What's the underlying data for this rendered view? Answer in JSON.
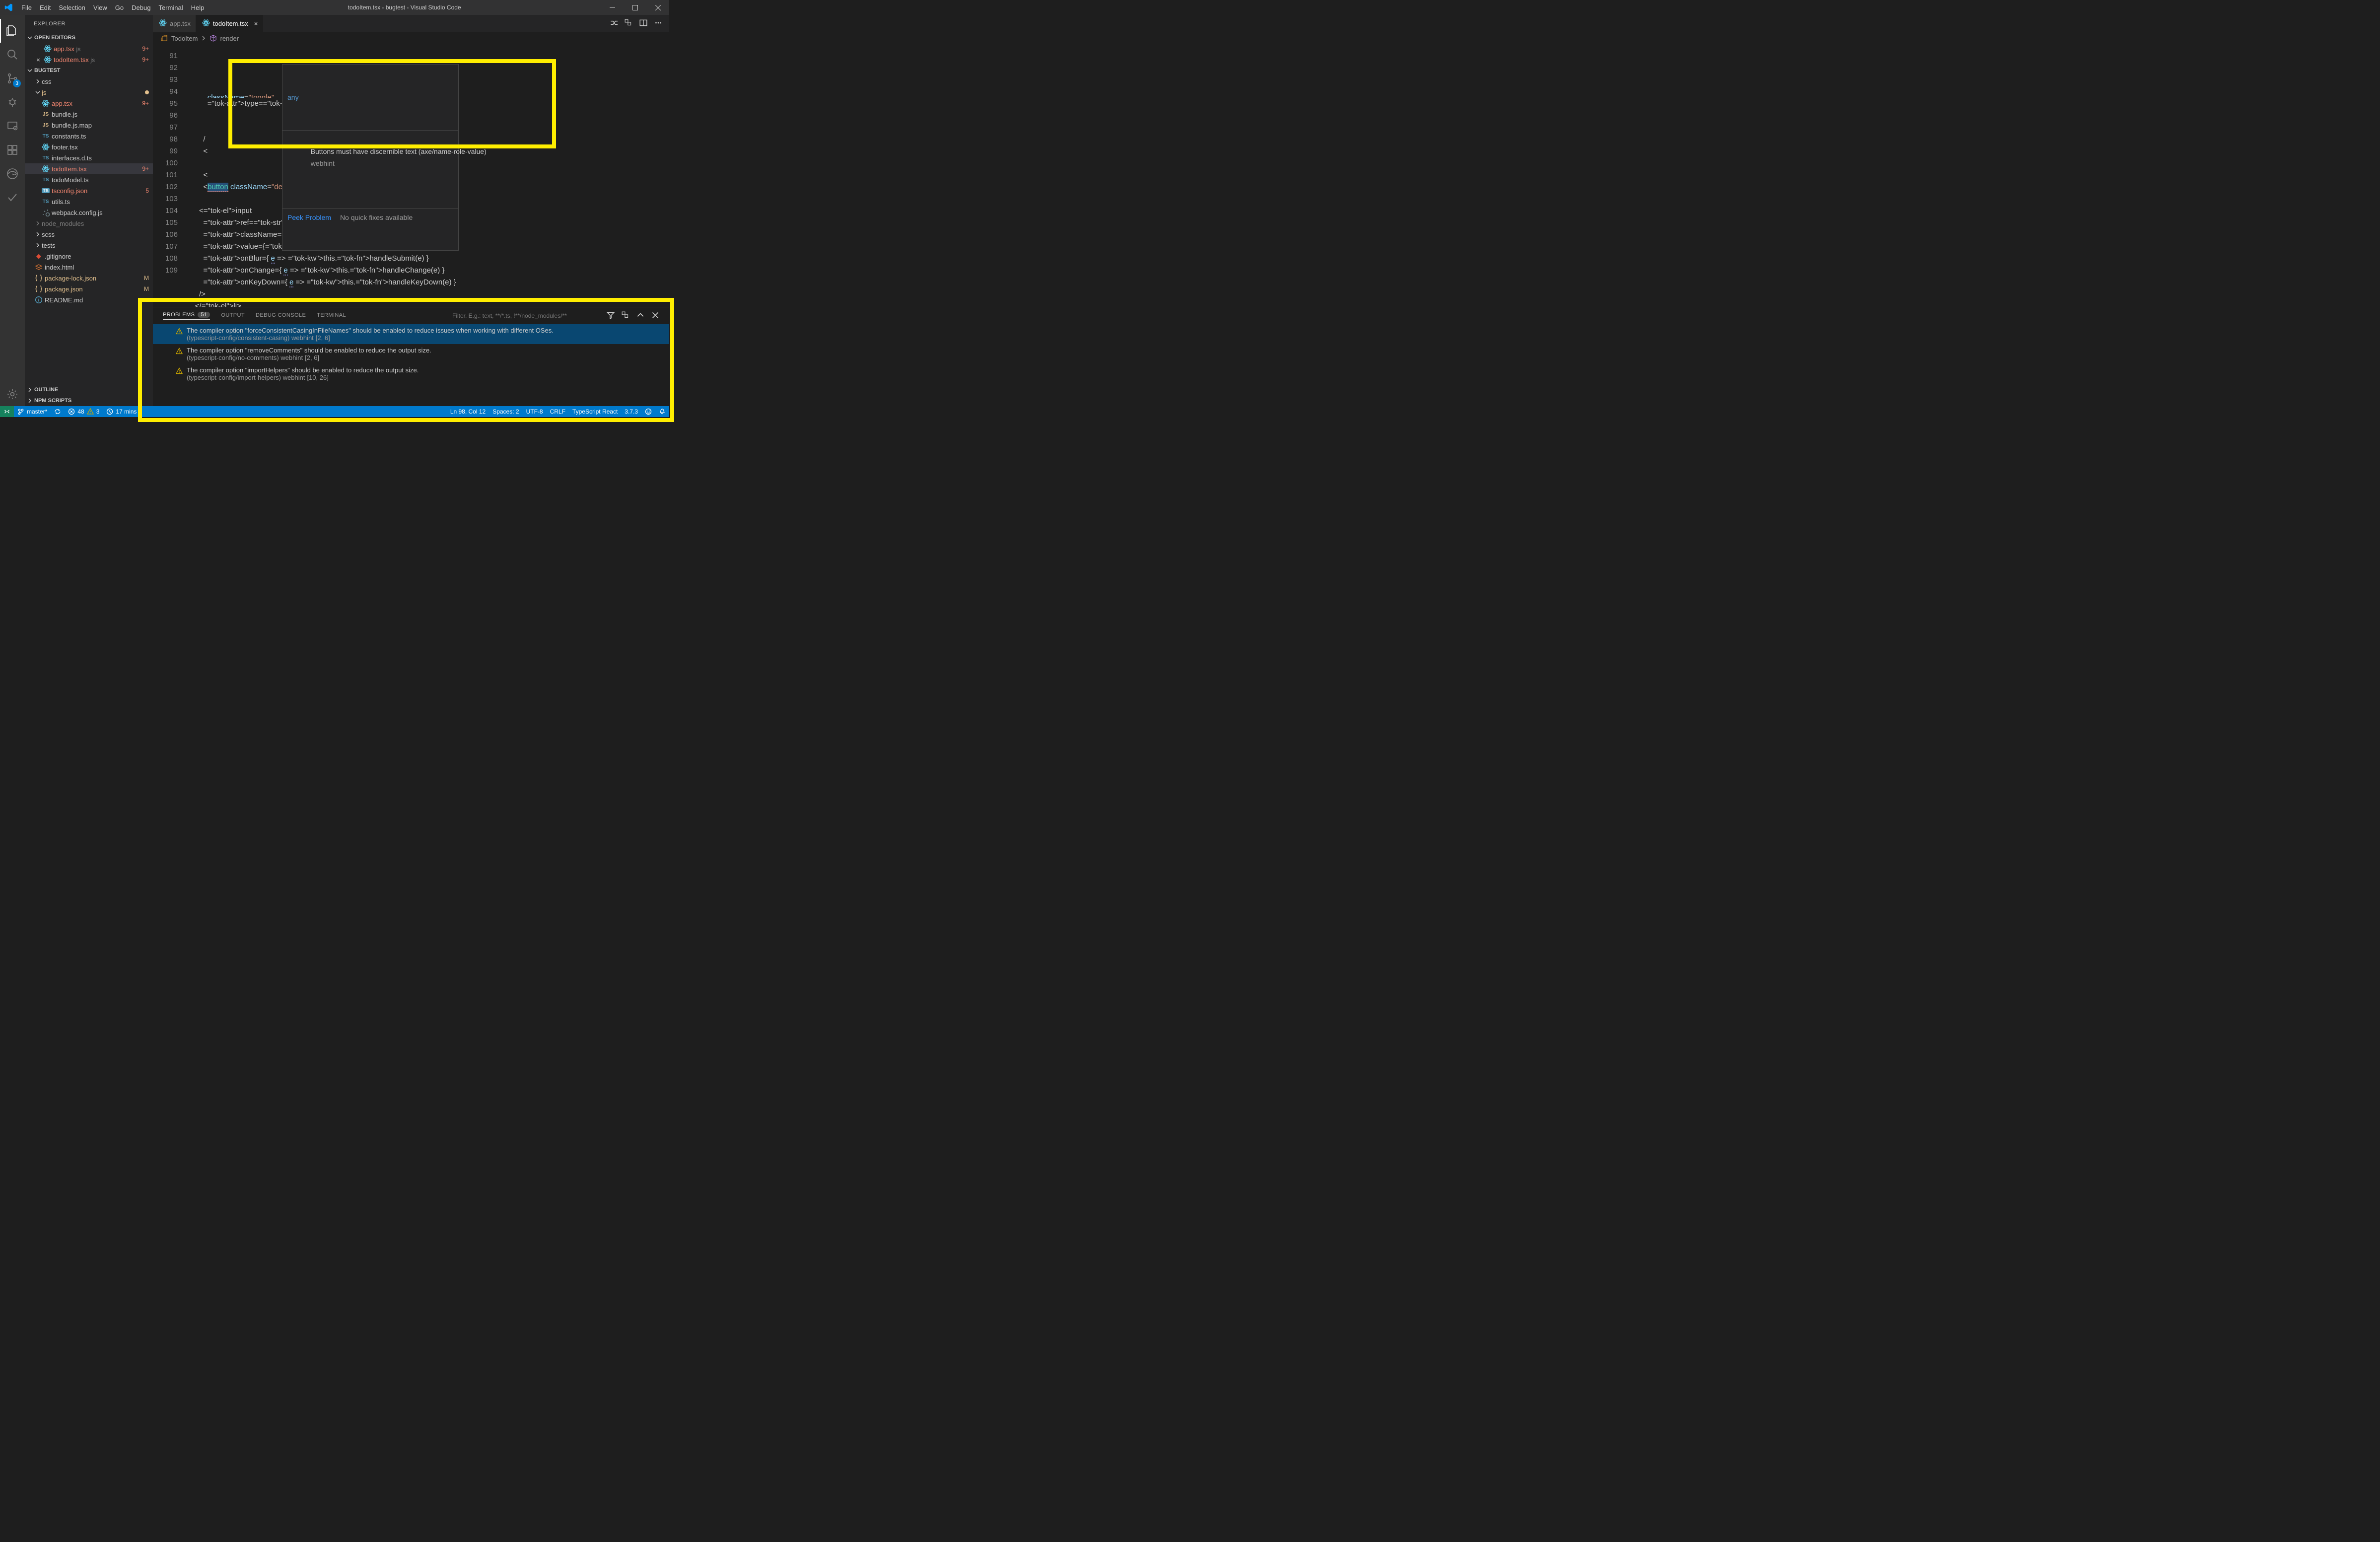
{
  "title": "todoItem.tsx - bugtest - Visual Studio Code",
  "menu": [
    "File",
    "Edit",
    "Selection",
    "View",
    "Go",
    "Debug",
    "Terminal",
    "Help"
  ],
  "activity": {
    "scm_badge": "3"
  },
  "sidebar": {
    "title": "EXPLORER",
    "panes": {
      "openEditors": "OPEN EDITORS",
      "project": "BUGTEST",
      "outline": "OUTLINE",
      "npm": "NPM SCRIPTS"
    },
    "openEditors": [
      {
        "name": "app.tsx",
        "tag": "js",
        "badge": "9+",
        "err": true
      },
      {
        "name": "todoItem.tsx",
        "tag": "js",
        "badge": "9+",
        "err": true,
        "active": true
      }
    ],
    "tree": [
      {
        "t": "dir",
        "name": "css",
        "d": 1,
        "open": false
      },
      {
        "t": "dir",
        "name": "js",
        "d": 1,
        "open": true,
        "mod": true
      },
      {
        "t": "file",
        "name": "app.tsx",
        "d": 2,
        "ic": "react",
        "err": true,
        "badge": "9+"
      },
      {
        "t": "file",
        "name": "bundle.js",
        "d": 2,
        "ic": "js"
      },
      {
        "t": "file",
        "name": "bundle.js.map",
        "d": 2,
        "ic": "js"
      },
      {
        "t": "file",
        "name": "constants.ts",
        "d": 2,
        "ic": "ts"
      },
      {
        "t": "file",
        "name": "footer.tsx",
        "d": 2,
        "ic": "react"
      },
      {
        "t": "file",
        "name": "interfaces.d.ts",
        "d": 2,
        "ic": "ts"
      },
      {
        "t": "file",
        "name": "todoItem.tsx",
        "d": 2,
        "ic": "react",
        "err": true,
        "badge": "9+",
        "sel": true
      },
      {
        "t": "file",
        "name": "todoModel.ts",
        "d": 2,
        "ic": "ts"
      },
      {
        "t": "file",
        "name": "tsconfig.json",
        "d": 2,
        "ic": "tsd",
        "err": true,
        "badge": "5"
      },
      {
        "t": "file",
        "name": "utils.ts",
        "d": 2,
        "ic": "ts"
      },
      {
        "t": "file",
        "name": "webpack.config.js",
        "d": 2,
        "ic": "gear"
      },
      {
        "t": "dir",
        "name": "node_modules",
        "d": 1,
        "open": false,
        "dim": true
      },
      {
        "t": "dir",
        "name": "scss",
        "d": 1,
        "open": false
      },
      {
        "t": "dir",
        "name": "tests",
        "d": 1,
        "open": false
      },
      {
        "t": "file",
        "name": ".gitignore",
        "d": 1,
        "ic": "git"
      },
      {
        "t": "file",
        "name": "index.html",
        "d": 1,
        "ic": "html"
      },
      {
        "t": "file",
        "name": "package-lock.json",
        "d": 1,
        "ic": "json",
        "mod": true,
        "badge": "M"
      },
      {
        "t": "file",
        "name": "package.json",
        "d": 1,
        "ic": "json",
        "mod": true,
        "badge": "M"
      },
      {
        "t": "file",
        "name": "README.md",
        "d": 1,
        "ic": "md"
      }
    ]
  },
  "tabs": [
    {
      "name": "app.tsx",
      "active": false
    },
    {
      "name": "todoItem.tsx",
      "active": true
    }
  ],
  "breadcrumbs": [
    {
      "ic": "class",
      "text": "TodoItem"
    },
    {
      "ic": "cube",
      "text": "render"
    }
  ],
  "gutter_start": 91,
  "code_prelude": "          type=\"checkbox\"",
  "code": [
    "          type=\"checkbox\"",
    "",
    "",
    "        /",
    "        <                                          leEdit() }>",
    "",
    "        <",
    "        <button className=\"destroy\" onClick={this.props.onDestroy} />",
    "",
    "      <input",
    "        ref=\"editField\"",
    "        className=\"edit\"",
    "        value={this.state.editText}",
    "        onBlur={ e => this.handleSubmit(e) }",
    "        onChange={ e => this.handleChange(e) }",
    "        onKeyDown={ e => this.handleKeyDown(e) }",
    "      />",
    "    </li>",
    "  );"
  ],
  "hover": {
    "type": "any",
    "msg": "Buttons must have discernible text (axe/name-role-value)",
    "src": "webhint",
    "peek": "Peek Problem",
    "nofix": "No quick fixes available"
  },
  "panel": {
    "tabs": {
      "problems": "PROBLEMS",
      "output": "OUTPUT",
      "debug": "DEBUG CONSOLE",
      "terminal": "TERMINAL"
    },
    "problems_count": "51",
    "filter_placeholder": "Filter. E.g.: text, **/*.ts, !**/node_modules/**",
    "problems": [
      {
        "msg": "The compiler option \"forceConsistentCasingInFileNames\" should be enabled to reduce issues when working with different OSes.",
        "rule": "(typescript-config/consistent-casing)",
        "src": "webhint",
        "loc": "[2, 6]",
        "sel": true
      },
      {
        "msg": "The compiler option \"removeComments\" should be enabled to reduce the output size.",
        "rule": "(typescript-config/no-comments)",
        "src": "webhint",
        "loc": "[2, 6]"
      },
      {
        "msg": "The compiler option \"importHelpers\" should be enabled to reduce the output size.",
        "rule": "(typescript-config/import-helpers)",
        "src": "webhint",
        "loc": "[10, 26]"
      }
    ]
  },
  "status": {
    "branch": "master*",
    "errors": "48",
    "warnings": "3",
    "time": "17 mins",
    "pos": "Ln 98, Col 12",
    "spaces": "Spaces: 2",
    "enc": "UTF-8",
    "eol": "CRLF",
    "lang": "TypeScript React",
    "ver": "3.7.3"
  }
}
